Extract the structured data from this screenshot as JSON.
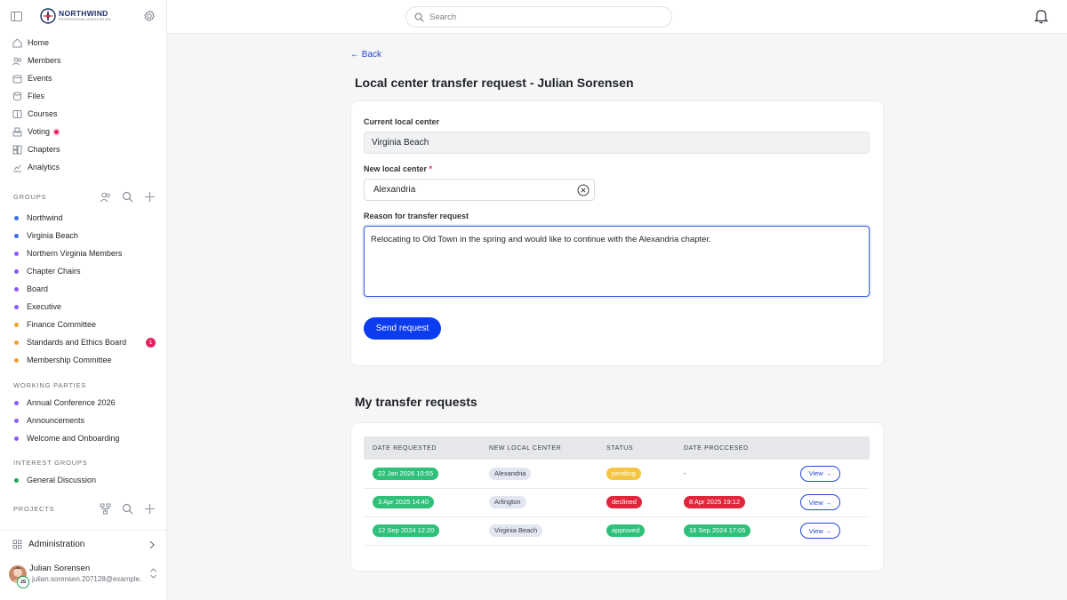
{
  "brand": {
    "name": "NORTHWIND",
    "tagline": "PROFESSIONAL ASSOCIATION"
  },
  "search": {
    "placeholder": "Search"
  },
  "nav": [
    {
      "label": "Home",
      "icon": "home-icon"
    },
    {
      "label": "Members",
      "icon": "members-icon"
    },
    {
      "label": "Events",
      "icon": "calendar-icon"
    },
    {
      "label": "Files",
      "icon": "files-icon"
    },
    {
      "label": "Courses",
      "icon": "book-icon"
    },
    {
      "label": "Voting",
      "icon": "ballot-icon"
    },
    {
      "label": "Chapters",
      "icon": "chapters-icon"
    },
    {
      "label": "Analytics",
      "icon": "chart-icon"
    }
  ],
  "groups": {
    "label": "GROUPS",
    "items": [
      {
        "label": "Northwind",
        "color": "#3b6fe0"
      },
      {
        "label": "Virginia Beach",
        "color": "#3b6fe0"
      },
      {
        "label": "Northern Virginia Members",
        "color": "#8b5cf6"
      },
      {
        "label": "Chapter Chairs",
        "color": "#8b5cf6"
      },
      {
        "label": "Board",
        "color": "#8b5cf6"
      },
      {
        "label": "Executive",
        "color": "#8b5cf6"
      },
      {
        "label": "Finance Committee",
        "color": "#f0a030"
      },
      {
        "label": "Standards and Ethics Board",
        "color": "#f0a030",
        "badge": "1"
      },
      {
        "label": "Membership Committee",
        "color": "#f0a030"
      }
    ]
  },
  "working_parties": {
    "label": "WORKING PARTIES",
    "items": [
      {
        "label": "Annual Conference 2026",
        "color": "#8b5cf6"
      },
      {
        "label": "Announcements",
        "color": "#8b5cf6"
      },
      {
        "label": "Welcome and Onboarding",
        "color": "#8b5cf6"
      }
    ]
  },
  "interest_groups": {
    "label": "INTEREST GROUPS",
    "items": [
      {
        "label": "General Discussion",
        "color": "#22a55a"
      }
    ]
  },
  "projects": {
    "label": "PROJECTS"
  },
  "administration": {
    "label": "Administration"
  },
  "user": {
    "name": "Julian Sorensen",
    "email": "julian.sorensen.207128@example...",
    "initials": "JS"
  },
  "page": {
    "back": "← Back",
    "title": "Local center transfer request - Julian Sorensen",
    "current_label": "Current local center",
    "current_value": "Virginia Beach",
    "new_label": "New local center",
    "required_mark": "*",
    "new_value": "Alexandria",
    "reason_label": "Reason for transfer request",
    "reason_value": "Relocating to Old Town in the spring and would like to continue with the Alexandria chapter.",
    "send_button": "Send request"
  },
  "requests": {
    "title": "My transfer requests",
    "headers": [
      "DATE REQUESTED",
      "NEW LOCAL CENTER",
      "STATUS",
      "DATE PROCCESED",
      ""
    ],
    "rows": [
      {
        "date": "22 Jan 2026 10:55",
        "center": "Alexandria",
        "status": "pending",
        "status_color": "#f5c542",
        "processed": "-",
        "processed_color": "",
        "action": "View →"
      },
      {
        "date": "3 Apr 2025 14:40",
        "center": "Arlington",
        "status": "declined",
        "status_color": "#e1263b",
        "processed": "8 Apr 2025 19:12",
        "processed_color": "#e1263b",
        "action": "View →"
      },
      {
        "date": "12 Sep 2024 12:20",
        "center": "Virginia Beach",
        "status": "approved",
        "status_color": "#2fc07a",
        "processed": "16 Sep 2024 17:05",
        "processed_color": "#2fc07a",
        "action": "View →"
      }
    ]
  }
}
